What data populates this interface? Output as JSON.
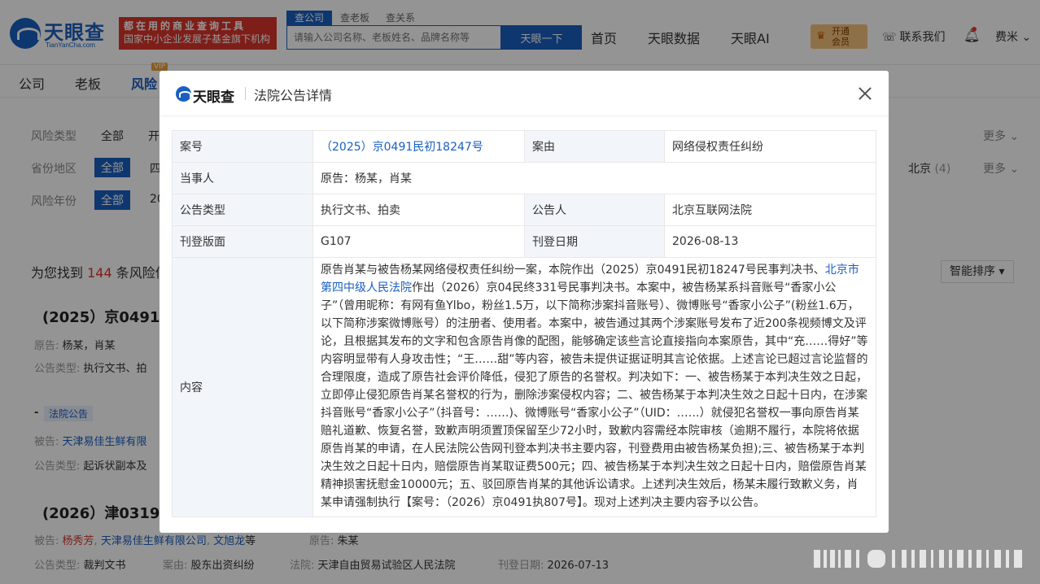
{
  "header": {
    "logo_text": "天眼查",
    "logo_sub": "TianYanCha.com",
    "promo_line1": "都在用的商业查询工具",
    "promo_line2": "国家中小企业发展子基金旗下机构",
    "search_tabs": [
      "查公司",
      "查老板",
      "查关系"
    ],
    "search_placeholder": "请输入公司名称、老板姓名、品牌名称等",
    "search_button": "天眼一下",
    "nav": [
      "首页",
      "天眼数据",
      "天眼AI"
    ],
    "vip_label_1": "开通",
    "vip_label_2": "会员",
    "contact": "联系我们",
    "user": "费米"
  },
  "subnav": {
    "tabs": [
      "公司",
      "老板",
      "风险"
    ],
    "vip_badge": "VIP"
  },
  "filters": {
    "type_label": "风险类型",
    "type_all": "全部",
    "type_next": "开",
    "region_label": "省份地区",
    "region_all": "全部",
    "region_next": "四",
    "year_label": "风险年份",
    "year_all": "全部",
    "year_next": "20",
    "more": "更多",
    "region_beijing": "北京",
    "region_beijing_count": "(4)"
  },
  "results": {
    "prefix": "为您找到",
    "count": "144",
    "suffix": "条风险信",
    "sort": "智能排序",
    "items": [
      {
        "title": "(2025）京0491民",
        "parties_label": "原告:",
        "parties": "杨某，肖某",
        "type_label": "公告类型:",
        "type": "执行文书、拍"
      },
      {
        "tag": "法院公告",
        "defendant_label": "被告:",
        "defendant": "天津易佳生鲜有限",
        "type_label": "公告类型:",
        "type": "起诉状副本及"
      },
      {
        "title": "(2026）津0319民",
        "defendant_label": "被告:",
        "defendant_1": "杨秀芳",
        "defendant_2": "天津易佳生鲜有限公司",
        "defendant_3": "文旭龙",
        "defendant_suffix": "等",
        "plaintiff_label": "原告:",
        "plaintiff": "朱某",
        "type_label": "公告类型:",
        "type": "裁判文书",
        "reason_label": "案由:",
        "reason": "股东出资纠纷",
        "court_label": "法院:",
        "court": "天津自由贸易试验区人民法院",
        "date_label": "刊登日期:",
        "date": "2026-07-13"
      }
    ]
  },
  "modal": {
    "logo": "天眼查",
    "title": "法院公告详情",
    "rows": {
      "case_no_label": "案号",
      "case_no": "（2025）京0491民初18247号",
      "cause_label": "案由",
      "cause": "网络侵权责任纠纷",
      "party_label": "当事人",
      "party": "原告：杨某，肖某",
      "type_label": "公告类型",
      "type": "执行文书、拍卖",
      "announcer_label": "公告人",
      "announcer": "北京互联网法院",
      "page_label": "刊登版面",
      "page": "G107",
      "date_label": "刊登日期",
      "date": "2026-08-13",
      "content_label": "内容",
      "content_part1": "原告肖某与被告杨某网络侵权责任纠纷一案，本院作出（2025）京0491民初18247号民事判决书、",
      "content_link": "北京市第四中级人民法院",
      "content_part2": "作出（2026）京04民终331号民事判决书。本案中，被告杨某系抖音账号“香家小公子”（曾用昵称：有网有鱼Ylbo，粉丝1.5万，以下简称涉案抖音账号）、微博账号“香家小公子”(粉丝1.6万，以下简称涉案微博账号）的注册者、使用者。本案中，被告通过其两个涉案账号发布了近200条视频博文及评论，且根据其发布的文字和包含原告肖像的配图，能够确定该些言论直接指向本案原告，其中“充……得好”等内容明显带有人身攻击性；“王……甜”等内容，被告未提供证据证明其言论依据。上述言论已超过言论监督的合理限度，造成了原告社会评价降低，侵犯了原告的名誉权。判决如下：一、被告杨某于本判决生效之日起，立即停止侵犯原告肖某名誉权的行为，删除涉案侵权内容；二、被告杨某于本判决生效之日起十日内，在涉案抖音账号“香家小公子”（抖音号：……)、微博账号“香家小公子”（UID：……）就侵犯名誉权一事向原告肖某赔礼道歉、恢复名誉，致歉声明须置顶保留至少72小时，致歉内容需经本院审核（逾期不履行，本院将依据原告肖某的申请，在人民法院公告网刊登本判决书主要内容，刊登费用由被告杨某负担);三、被告杨某于本判决生效之日起十日内，赔偿原告肖某取证费500元；四、被告杨某于本判决生效之日起十日内，赔偿原告肖某精神损害抚慰金10000元；五、驳回原告肖某的其他诉讼请求。上述判决生效后，杨某未履行致歉义务，肖某申请强制执行【案号：（2026）京0491执807号】。现对上述判决主要内容予以公告。"
    }
  }
}
